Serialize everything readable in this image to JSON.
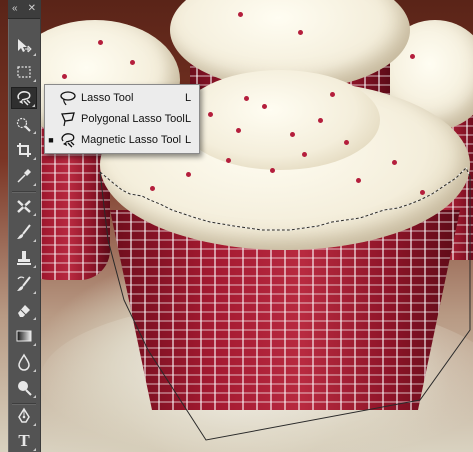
{
  "toolbar": {
    "collapse_glyph": "«",
    "close_glyph": "✕",
    "tools": [
      {
        "name": "move-tool",
        "icon": "move-icon"
      },
      {
        "name": "marquee-tool",
        "icon": "rect-marquee-icon"
      },
      {
        "name": "lasso-tool",
        "icon": "magnetic-lasso-icon",
        "active": true
      },
      {
        "name": "quick-selection-tool",
        "icon": "quick-selection-icon"
      },
      {
        "name": "crop-tool",
        "icon": "crop-icon"
      },
      {
        "name": "eyedropper-tool",
        "icon": "eyedropper-icon"
      },
      {
        "name": "healing-brush-tool",
        "icon": "healing-brush-icon"
      },
      {
        "name": "brush-tool",
        "icon": "brush-icon"
      },
      {
        "name": "clone-stamp-tool",
        "icon": "clone-stamp-icon"
      },
      {
        "name": "history-brush-tool",
        "icon": "history-brush-icon"
      },
      {
        "name": "eraser-tool",
        "icon": "eraser-icon"
      },
      {
        "name": "gradient-tool",
        "icon": "gradient-icon"
      },
      {
        "name": "blur-tool",
        "icon": "blur-drop-icon"
      },
      {
        "name": "dodge-tool",
        "icon": "dodge-icon"
      },
      {
        "name": "pen-tool",
        "icon": "pen-icon"
      },
      {
        "name": "type-tool",
        "icon": "type-icon",
        "glyph": "T"
      }
    ]
  },
  "flyout": {
    "items": [
      {
        "label": "Lasso Tool",
        "shortcut": "L",
        "icon": "lasso-icon",
        "selected": false,
        "bullet": ""
      },
      {
        "label": "Polygonal Lasso Tool",
        "shortcut": "L",
        "icon": "polygonal-lasso-icon",
        "selected": false,
        "bullet": ""
      },
      {
        "label": "Magnetic Lasso Tool",
        "shortcut": "L",
        "icon": "magnetic-lasso-icon",
        "selected": true,
        "bullet": "■"
      }
    ]
  },
  "colors": {
    "panel": "#535353",
    "flyout_bg": "#ececec",
    "frosting": "#f4eedb",
    "wrapper_red": "#a51a31",
    "sprinkle": "#b41e3c"
  }
}
